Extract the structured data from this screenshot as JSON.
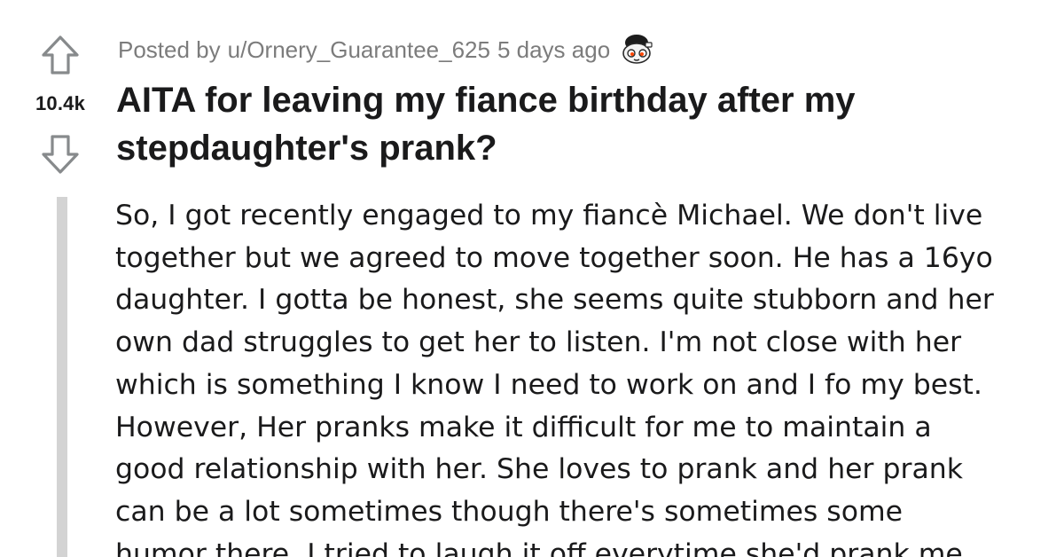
{
  "post": {
    "score": "10.4k",
    "posted_by_prefix": "Posted by",
    "author": "u/Ornery_Guarantee_625",
    "age": "5 days ago",
    "title": "AITA for leaving my fiance birthday after my stepdaughter's prank?",
    "body": "So, I got recently engaged to my fiancè Michael. We don't live\ntogether but we agreed to move together soon. He has a 16yo\ndaughter. I gotta be honest, she seems quite stubborn and her\nown dad struggles to get her to listen. I'm not close with her\nwhich is something I know I need to work on and I fo my best.\nHowever, Her pranks make it difficult for me to maintain a\ngood relationship with her. She loves to prank and her prank\ncan be a lot sometimes though there's sometimes some\nhumor there. I tried to laugh it off everytime she'd prank me"
  },
  "icons": {
    "upvote": "upvote-arrow-icon",
    "downvote": "downvote-arrow-icon",
    "avatar": "snoo-avatar-icon"
  },
  "colors": {
    "text": "#1a1a1b",
    "meta": "#7c7c7c",
    "icon_stroke": "#878a8c",
    "thread_line": "#d3d3d3"
  }
}
